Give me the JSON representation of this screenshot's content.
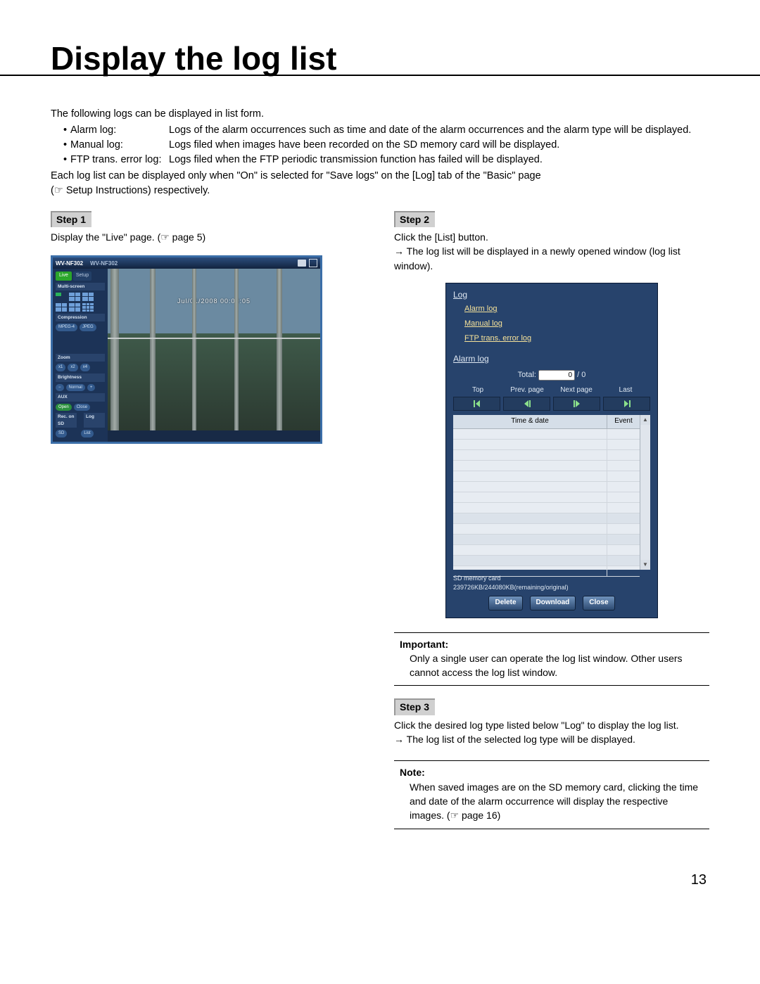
{
  "page_number": "13",
  "title": "Display the log list",
  "intro_line": "The following logs can be displayed in list form.",
  "log_types": [
    {
      "label": "Alarm log:",
      "desc": "Logs of the alarm occurrences such as time and date of the alarm occurrences and the alarm type will be displayed."
    },
    {
      "label": "Manual log:",
      "desc": "Logs filed when images have been recorded on the SD memory card will be displayed."
    },
    {
      "label": "FTP trans. error log:",
      "desc": "Logs filed when the FTP periodic transmission function has failed will be displayed."
    }
  ],
  "intro_tail1": "Each log list can be displayed only when \"On\" is selected for \"Save logs\" on the [Log] tab of the \"Basic\" page",
  "intro_tail2": "(☞ Setup Instructions) respectively.",
  "steps": {
    "s1": {
      "label": "Step 1",
      "text": "Display the \"Live\" page. (☞ page 5)"
    },
    "s2": {
      "label": "Step 2",
      "text1": "Click the [List] button.",
      "text2": "→ The log list will be displayed in a newly opened window (log list window)."
    },
    "s3": {
      "label": "Step 3",
      "text1": "Click the desired log type listed below \"Log\" to display the log list.",
      "text2": "→ The log list of the selected log type will be displayed."
    }
  },
  "important": {
    "title": "Important:",
    "body": "Only a single user can operate the log list window. Other users cannot access the log list window."
  },
  "note": {
    "title": "Note:",
    "body": "When saved images are on the SD memory card, clicking the time and date of the alarm occurrence will display the respective images. (☞ page 16)"
  },
  "live_page": {
    "model_l": "WV-NF302",
    "model_r": "WV-NF302",
    "tab_live": "Live",
    "tab_setup": "Setup",
    "sec_multiscreen": "Multi-screen",
    "sec_compression": "Compression",
    "pill_mpeg4": "MPEG-4",
    "pill_jpeg": "JPEG",
    "sec_zoom": "Zoom",
    "z_x1": "x1",
    "z_x2": "x2",
    "z_x4": "x4",
    "sec_brightness": "Brightness",
    "b_minus": "−",
    "b_normal": "Normal",
    "b_plus": "+",
    "sec_aux": "AUX",
    "aux_open": "Open",
    "aux_close": "Close",
    "sec_rec": "Rec. on SD",
    "sec_log": "Log",
    "rec_sd": "SD",
    "log_list_btn": "List",
    "timestamp": "Jul/01/2008 00:00:05"
  },
  "log_window": {
    "head": "Log",
    "link_alarm": "Alarm log",
    "link_manual": "Manual log",
    "link_ftp": "FTP trans. error log",
    "current": "Alarm log",
    "total_label": "Total:",
    "total_value": "0",
    "total_suffix": "/ 0",
    "pager": {
      "top": "Top",
      "prev": "Prev. page",
      "next": "Next page",
      "last": "Last"
    },
    "col_time": "Time & date",
    "col_event": "Event",
    "sd_label": "SD memory card",
    "sd_info": "239726KB/244080KB(remaining/original)",
    "btn_delete": "Delete",
    "btn_download": "Download",
    "btn_close": "Close"
  }
}
